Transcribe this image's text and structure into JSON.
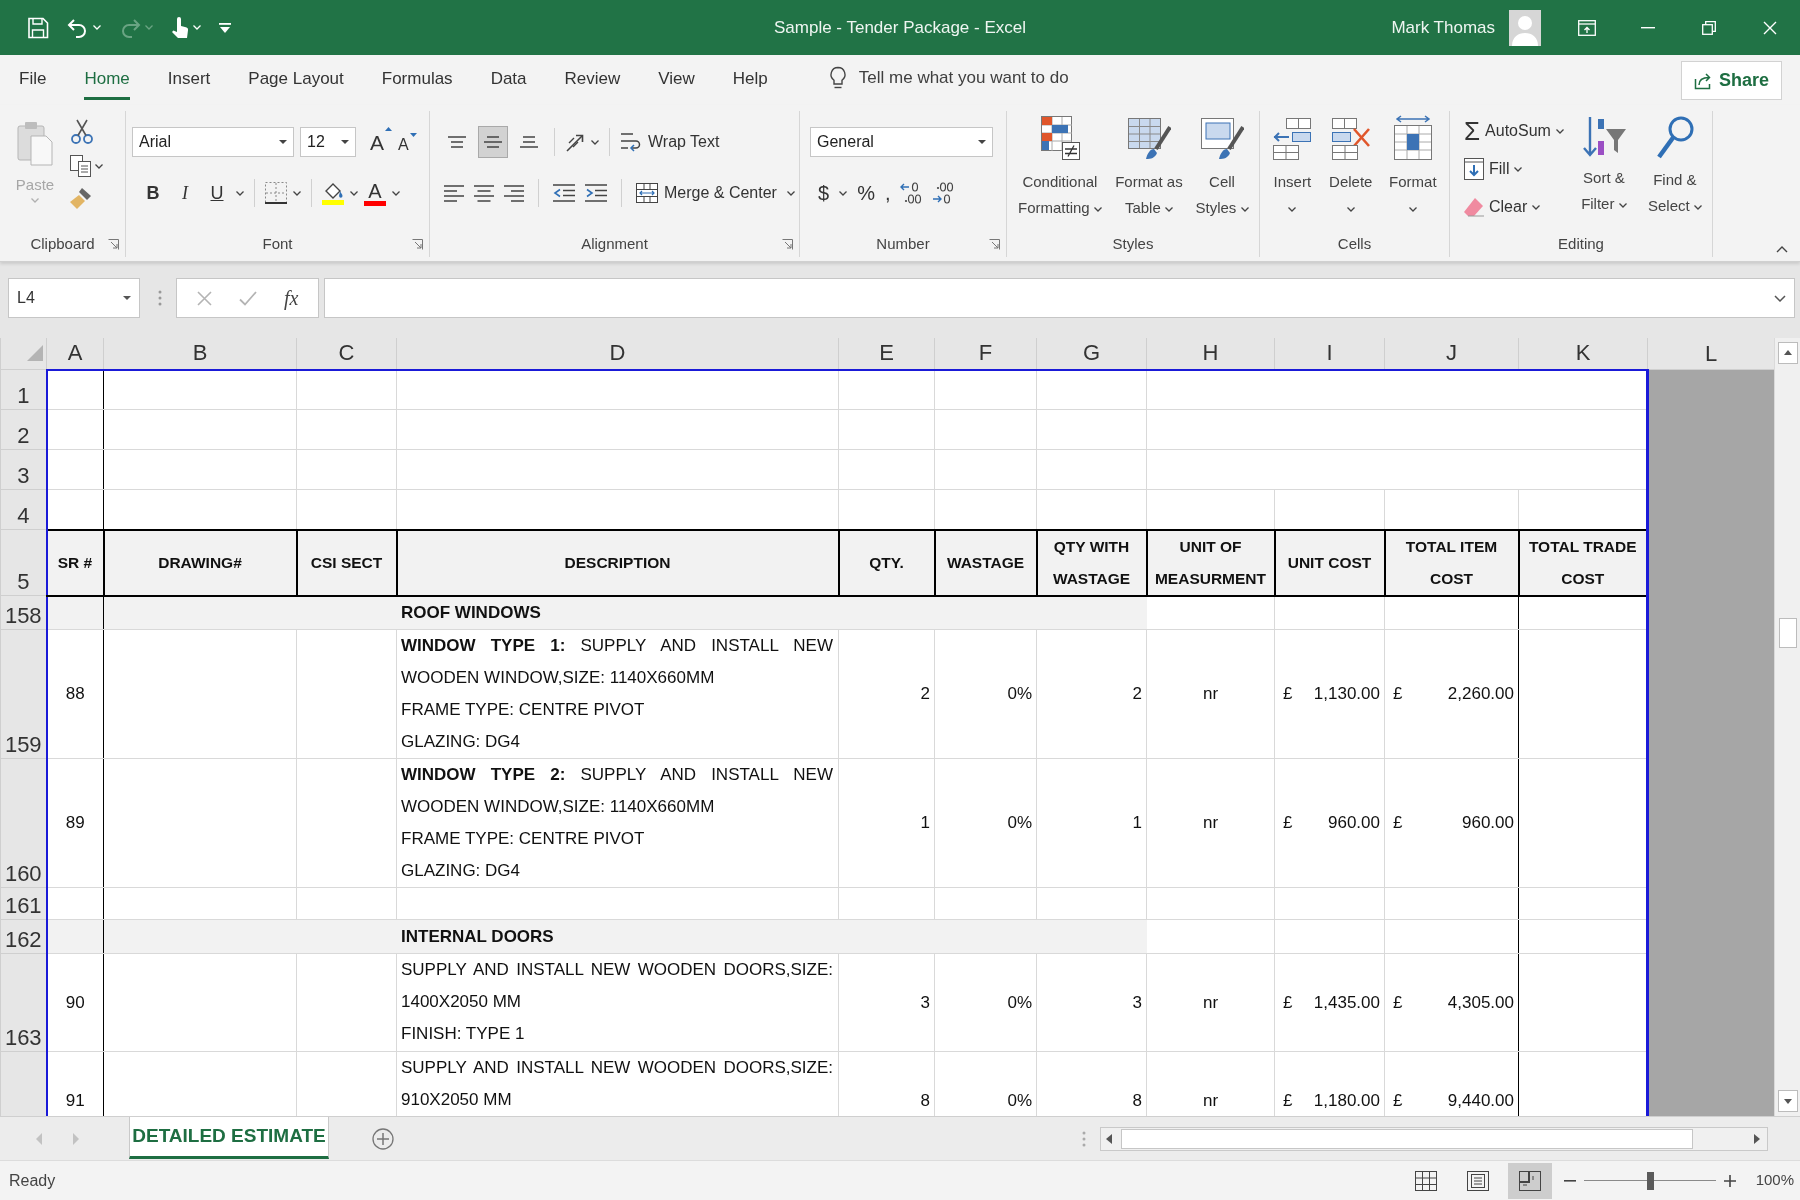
{
  "window": {
    "title": "Sample - Tender Package - Excel",
    "user": "Mark Thomas"
  },
  "quick_access": [
    {
      "kind": "save",
      "disabled": false
    },
    {
      "kind": "undo",
      "disabled": false
    },
    {
      "kind": "redo",
      "disabled": true
    },
    {
      "kind": "touch",
      "disabled": false
    },
    {
      "kind": "customize",
      "disabled": false
    }
  ],
  "ribbon_tabs": [
    {
      "label": "File",
      "selected": false
    },
    {
      "label": "Home",
      "selected": true
    },
    {
      "label": "Insert",
      "selected": false
    },
    {
      "label": "Page Layout",
      "selected": false
    },
    {
      "label": "Formulas",
      "selected": false
    },
    {
      "label": "Data",
      "selected": false
    },
    {
      "label": "Review",
      "selected": false
    },
    {
      "label": "View",
      "selected": false
    },
    {
      "label": "Help",
      "selected": false
    }
  ],
  "tell_me": {
    "placeholder": "Tell me what you want to do"
  },
  "share": {
    "label": "Share"
  },
  "ribbon_groups": [
    {
      "kind": "clipboard",
      "label": "Clipboard",
      "paste": {
        "label": "Paste",
        "disabled": true
      }
    },
    {
      "kind": "font",
      "label": "Font",
      "font_name": "Arial",
      "font_size": "12",
      "grow": "A",
      "shrink": "A",
      "bold": "B",
      "italic": "I",
      "underline": "U",
      "font_color": "A"
    },
    {
      "kind": "alignment",
      "label": "Alignment",
      "vertical": [
        {
          "kind": "top",
          "selected": false
        },
        {
          "kind": "middle",
          "selected": true
        },
        {
          "kind": "bottom",
          "selected": false
        }
      ],
      "wrap_text": "Wrap Text",
      "merge": "Merge & Center"
    },
    {
      "kind": "number",
      "label": "Number",
      "format": "General",
      "currency": "$",
      "percent": "%",
      "comma": ","
    },
    {
      "kind": "styles",
      "label": "Styles",
      "buttons": [
        {
          "kind": "conditional",
          "label": "Conditional Formatting"
        },
        {
          "kind": "table",
          "label": "Format as Table"
        },
        {
          "kind": "cell_styles",
          "label": "Cell Styles"
        }
      ]
    },
    {
      "kind": "cells",
      "label": "Cells",
      "buttons": [
        {
          "kind": "insert",
          "label": "Insert"
        },
        {
          "kind": "delete",
          "label": "Delete"
        },
        {
          "kind": "format",
          "label": "Format"
        }
      ]
    },
    {
      "kind": "editing",
      "label": "Editing",
      "autosum": {
        "symbol": "Σ",
        "label": "AutoSum"
      },
      "fill": "Fill",
      "clear": "Clear",
      "buttons": [
        {
          "kind": "sort",
          "label": "Sort & Filter"
        },
        {
          "kind": "find",
          "label": "Find & Select"
        }
      ]
    }
  ],
  "formula_bar": {
    "name_box": "L4",
    "buttons": [
      {
        "kind": "cancel",
        "disabled": true
      },
      {
        "kind": "enter",
        "disabled": true
      }
    ],
    "function_label": "fx"
  },
  "sheet": {
    "columns": [
      "A",
      "B",
      "C",
      "D",
      "E",
      "F",
      "G",
      "H",
      "I",
      "J",
      "K",
      "L"
    ],
    "rows": [
      {
        "kind": "blank",
        "label": "1",
        "merged_tail": true
      },
      {
        "kind": "blank",
        "label": "2",
        "merged_tail": true
      },
      {
        "kind": "blank",
        "label": "3",
        "merged_tail": true
      },
      {
        "kind": "blank",
        "label": "4",
        "merged_tail": false
      },
      {
        "kind": "header",
        "label": "5",
        "cells": [
          "SR #",
          "DRAWING#",
          "CSI SECT",
          "DESCRIPTION",
          "QTY.",
          "WASTAGE",
          "QTY WITH WASTAGE",
          "UNIT OF MEASURMENT",
          "UNIT COST",
          "TOTAL ITEM COST",
          "TOTAL TRADE COST"
        ]
      },
      {
        "kind": "section",
        "label": "158",
        "title": "ROOF WINDOWS"
      },
      {
        "kind": "item",
        "label": "159",
        "sr": "88",
        "description": [
          "**WINDOW TYPE 1:** SUPPLY AND INSTALL NEW WOODEN WINDOW,SIZE: 1140X660MM",
          "FRAME TYPE: CENTRE PIVOT",
          "GLAZING: DG4"
        ],
        "qty": "2",
        "wastage": "0%",
        "qty_with_wastage": "2",
        "unit": "nr",
        "unit_cost": {
          "symbol": "£",
          "amount": "1,130.00"
        },
        "total_item_cost": {
          "symbol": "£",
          "amount": "2,260.00"
        }
      },
      {
        "kind": "item",
        "label": "160",
        "sr": "89",
        "description": [
          "**WINDOW TYPE 2:** SUPPLY AND INSTALL NEW WOODEN WINDOW,SIZE: 1140X660MM",
          "FRAME TYPE: CENTRE PIVOT",
          "GLAZING: DG4"
        ],
        "qty": "1",
        "wastage": "0%",
        "qty_with_wastage": "1",
        "unit": "nr",
        "unit_cost": {
          "symbol": "£",
          "amount": "960.00"
        },
        "total_item_cost": {
          "symbol": "£",
          "amount": "960.00"
        }
      },
      {
        "kind": "blank",
        "label": "161"
      },
      {
        "kind": "section",
        "label": "162",
        "title": "INTERNAL DOORS"
      },
      {
        "kind": "item",
        "label": "163",
        "sr": "90",
        "description": [
          "SUPPLY AND INSTALL NEW WOODEN DOORS,SIZE: 1400X2050 MM",
          "FINISH: TYPE 1"
        ],
        "qty": "3",
        "wastage": "0%",
        "qty_with_wastage": "3",
        "unit": "nr",
        "unit_cost": {
          "symbol": "£",
          "amount": "1,435.00"
        },
        "total_item_cost": {
          "symbol": "£",
          "amount": "4,305.00"
        }
      },
      {
        "kind": "item",
        "sr": "91",
        "description": [
          "SUPPLY AND INSTALL NEW WOODEN DOORS,SIZE: 910X2050 MM"
        ],
        "qty": "8",
        "wastage": "0%",
        "qty_with_wastage": "8",
        "unit": "nr",
        "unit_cost": {
          "symbol": "£",
          "amount": "1,180.00"
        },
        "total_item_cost": {
          "symbol": "£",
          "amount": "9,440.00"
        }
      }
    ]
  },
  "sheet_tabs": {
    "nav": [
      {
        "kind": "previous",
        "disabled": true
      },
      {
        "kind": "next",
        "disabled": true
      }
    ],
    "tabs": [
      {
        "label": "DETAILED ESTIMATE",
        "selected": true
      }
    ]
  },
  "status_bar": {
    "status": "Ready",
    "views": [
      {
        "kind": "normal",
        "selected": false
      },
      {
        "kind": "page_layout",
        "selected": false
      },
      {
        "kind": "page_break",
        "selected": true
      }
    ],
    "zoom": {
      "level": 0.5,
      "reading": "100%"
    }
  }
}
